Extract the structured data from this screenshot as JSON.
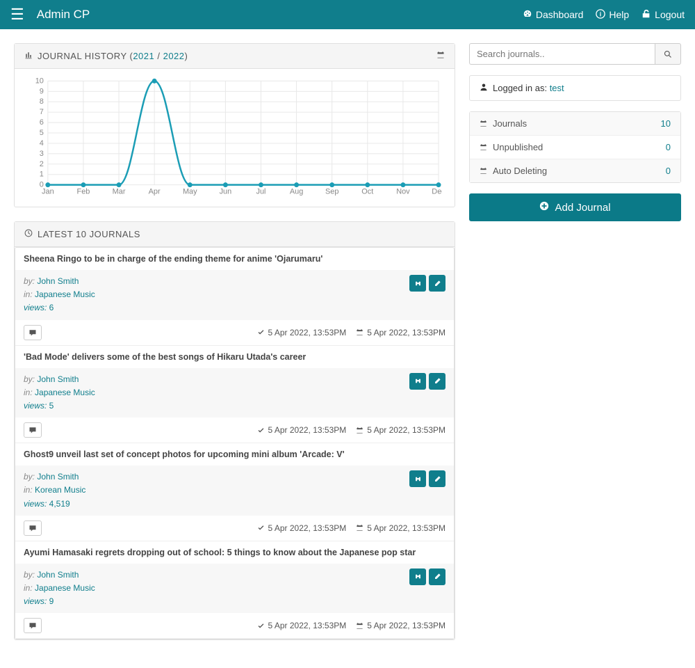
{
  "header": {
    "brand": "Admin CP",
    "nav": {
      "dashboard": "Dashboard",
      "help": "Help",
      "logout": "Logout"
    }
  },
  "chart_panel": {
    "title_prefix": "JOURNAL HISTORY (",
    "year1": "2021",
    "sep": " / ",
    "year2": "2022",
    "title_suffix": ")"
  },
  "chart_data": {
    "type": "line",
    "categories": [
      "Jan",
      "Feb",
      "Mar",
      "Apr",
      "May",
      "Jun",
      "Jul",
      "Aug",
      "Sep",
      "Oct",
      "Nov",
      "Dec"
    ],
    "values": [
      0,
      0,
      0,
      10,
      0,
      0,
      0,
      0,
      0,
      0,
      0,
      0
    ],
    "ylim": [
      0,
      10
    ],
    "yticks": [
      0,
      1,
      2,
      3,
      4,
      5,
      6,
      7,
      8,
      9,
      10
    ]
  },
  "search": {
    "placeholder": "Search journals.."
  },
  "login_info": {
    "prefix": "Logged in as: ",
    "user": "test"
  },
  "stats": [
    {
      "label": "Journals",
      "value": "10"
    },
    {
      "label": "Unpublished",
      "value": "0"
    },
    {
      "label": "Auto Deleting",
      "value": "0"
    }
  ],
  "add_button": "Add Journal",
  "latest": {
    "title": "LATEST 10 JOURNALS",
    "by_label": "by:",
    "in_label": "in:",
    "views_label": "views:",
    "items": [
      {
        "title": "Sheena Ringo to be in charge of the ending theme for anime 'Ojarumaru'",
        "by": "John Smith",
        "in": "Japanese Music",
        "views": "6",
        "d1": "5 Apr 2022, 13:53PM",
        "d2": "5 Apr 2022, 13:53PM"
      },
      {
        "title": "'Bad Mode' delivers some of the best songs of Hikaru Utada's career",
        "by": "John Smith",
        "in": "Japanese Music",
        "views": "5",
        "d1": "5 Apr 2022, 13:53PM",
        "d2": "5 Apr 2022, 13:53PM"
      },
      {
        "title": "Ghost9 unveil last set of concept photos for upcoming mini album 'Arcade: V'",
        "by": "John Smith",
        "in": "Korean Music",
        "views": "4,519",
        "d1": "5 Apr 2022, 13:53PM",
        "d2": "5 Apr 2022, 13:53PM"
      },
      {
        "title": "Ayumi Hamasaki regrets dropping out of school: 5 things to know about the Japanese pop star",
        "by": "John Smith",
        "in": "Japanese Music",
        "views": "9",
        "d1": "5 Apr 2022, 13:53PM",
        "d2": "5 Apr 2022, 13:53PM"
      }
    ]
  }
}
